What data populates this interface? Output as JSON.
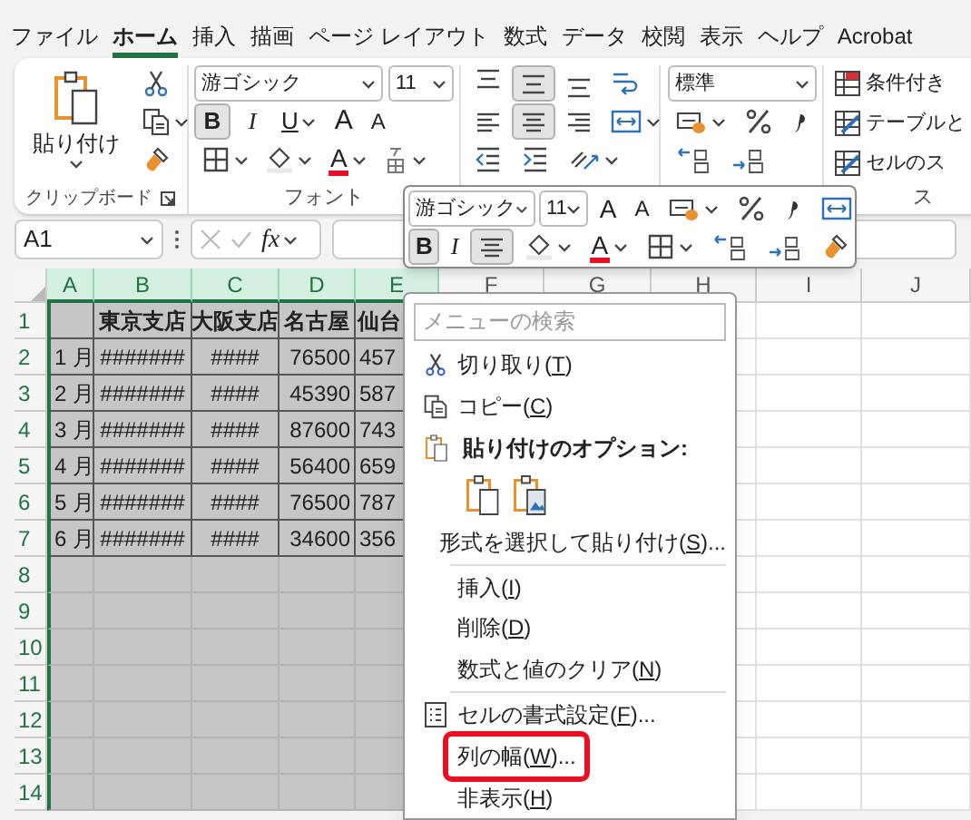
{
  "ribbon_tabs": [
    {
      "label": "ファイル",
      "selected": false
    },
    {
      "label": "ホーム",
      "selected": true
    },
    {
      "label": "挿入",
      "selected": false
    },
    {
      "label": "描画",
      "selected": false
    },
    {
      "label": "ページ レイアウト",
      "selected": false
    },
    {
      "label": "数式",
      "selected": false
    },
    {
      "label": "データ",
      "selected": false
    },
    {
      "label": "校閲",
      "selected": false
    },
    {
      "label": "表示",
      "selected": false
    },
    {
      "label": "ヘルプ",
      "selected": false
    },
    {
      "label": "Acrobat",
      "selected": false
    }
  ],
  "clipboard": {
    "paste_label": "貼り付け",
    "group_label": "クリップボード"
  },
  "font": {
    "font_name": "游ゴシック",
    "font_size": "11",
    "bold": {
      "label": "B",
      "on": true
    },
    "italic": {
      "label": "I",
      "on": false
    },
    "underline": {
      "label": "U",
      "on": false
    },
    "grow_font": "A",
    "shrink_font": "A",
    "font_color": "A",
    "group_label": "フォント"
  },
  "alignment": {
    "vertical": [
      {
        "on": false
      },
      {
        "on": true
      },
      {
        "on": false
      }
    ],
    "horizontal": [
      {
        "on": false
      },
      {
        "on": true
      },
      {
        "on": false
      }
    ]
  },
  "number": {
    "format": "標準"
  },
  "styles": {
    "items": [
      "条件付き",
      "テーブルと",
      "セルのス"
    ],
    "group_label": "ス"
  },
  "formula_bar": {
    "name_box": "A1",
    "function_label": "fx"
  },
  "sheet": {
    "columns": [
      {
        "label": "A",
        "selected": true
      },
      {
        "label": "B",
        "selected": true
      },
      {
        "label": "C",
        "selected": true
      },
      {
        "label": "D",
        "selected": true
      },
      {
        "label": "E",
        "selected": true
      },
      {
        "label": "F",
        "selected": false
      },
      {
        "label": "G",
        "selected": false
      },
      {
        "label": "H",
        "selected": false
      },
      {
        "label": "I",
        "selected": false
      },
      {
        "label": "J",
        "selected": false
      }
    ],
    "rows": [
      {
        "number": "1",
        "cells": [
          null,
          "東京支店",
          "大阪支店",
          "名古屋",
          "仙台"
        ]
      },
      {
        "number": "2",
        "cells": [
          "1 月",
          "#######",
          "####",
          "76500",
          "457"
        ]
      },
      {
        "number": "3",
        "cells": [
          "2 月",
          "#######",
          "####",
          "45390",
          "587"
        ]
      },
      {
        "number": "4",
        "cells": [
          "3 月",
          "#######",
          "####",
          "87600",
          "743"
        ]
      },
      {
        "number": "5",
        "cells": [
          "4 月",
          "#######",
          "####",
          "56400",
          "659"
        ]
      },
      {
        "number": "6",
        "cells": [
          "5 月",
          "#######",
          "####",
          "76500",
          "787"
        ]
      },
      {
        "number": "7",
        "cells": [
          "6 月",
          "#######",
          "####",
          "34600",
          "356"
        ]
      },
      {
        "number": "8",
        "cells": []
      },
      {
        "number": "9",
        "cells": []
      },
      {
        "number": "10",
        "cells": []
      },
      {
        "number": "11",
        "cells": []
      },
      {
        "number": "12",
        "cells": []
      },
      {
        "number": "13",
        "cells": []
      },
      {
        "number": "14",
        "cells": []
      }
    ]
  },
  "mini_toolbar": {
    "font_name": "游ゴシック",
    "font_size": "11",
    "grow_font": "A",
    "shrink_font": "A",
    "bold": {
      "label": "B",
      "on": true
    },
    "italic": {
      "label": "I",
      "on": false
    },
    "center": {
      "on": true
    },
    "font_color": "A"
  },
  "context_menu": {
    "search_placeholder": "メニューの検索",
    "items": [
      {
        "kind": "command",
        "label": "切り取り(T)",
        "highlighted": false
      },
      {
        "kind": "command",
        "label": "コピー(C)",
        "highlighted": false
      },
      {
        "kind": "header",
        "label": "貼り付けのオプション:"
      },
      {
        "kind": "paste_options"
      },
      {
        "kind": "command",
        "label": "形式を選択して貼り付け(S)...",
        "highlighted": false
      },
      {
        "kind": "separator"
      },
      {
        "kind": "command",
        "label": "挿入(I)",
        "highlighted": false
      },
      {
        "kind": "command",
        "label": "削除(D)",
        "highlighted": false
      },
      {
        "kind": "command",
        "label": "数式と値のクリア(N)",
        "highlighted": false
      },
      {
        "kind": "separator"
      },
      {
        "kind": "command",
        "label": "セルの書式設定(F)...",
        "highlighted": false
      },
      {
        "kind": "command",
        "label": "列の幅(W)...",
        "highlighted": true
      },
      {
        "kind": "command",
        "label": "非表示(H)",
        "highlighted": false
      }
    ]
  }
}
